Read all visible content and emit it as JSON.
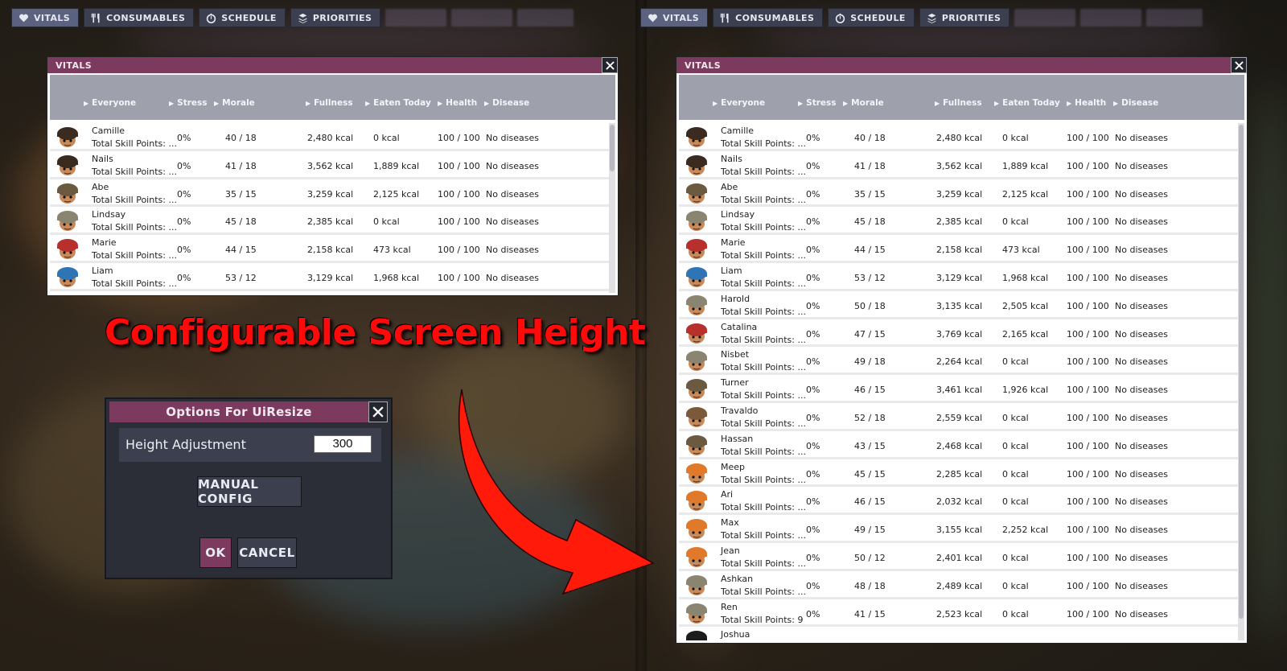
{
  "topbar": {
    "buttons": [
      {
        "label": "VITALS",
        "icon": "heart-icon"
      },
      {
        "label": "CONSUMABLES",
        "icon": "fork-knife-icon"
      },
      {
        "label": "SCHEDULE",
        "icon": "stopwatch-icon"
      },
      {
        "label": "PRIORITIES",
        "icon": "priority-stack-icon"
      }
    ]
  },
  "vitals_window": {
    "title": "VITALS",
    "columns": [
      "Everyone",
      "Stress",
      "Morale",
      "Fullness",
      "Eaten Today",
      "Health",
      "Disease"
    ]
  },
  "duplicants": [
    {
      "name": "Camille",
      "skill": "Total Skill Points: ...",
      "stress": "0%",
      "morale": "40 / 18",
      "fullness": "2,480 kcal",
      "eaten": "0 kcal",
      "health": "100 / 100",
      "disease": "No diseases",
      "hat": "miner"
    },
    {
      "name": "Nails",
      "skill": "Total Skill Points: ...",
      "stress": "0%",
      "morale": "41 / 18",
      "fullness": "3,562 kcal",
      "eaten": "1,889 kcal",
      "health": "100 / 100",
      "disease": "No diseases",
      "hat": "miner"
    },
    {
      "name": "Abe",
      "skill": "Total Skill Points: ...",
      "stress": "0%",
      "morale": "35 / 15",
      "fullness": "3,259 kcal",
      "eaten": "2,125 kcal",
      "health": "100 / 100",
      "disease": "No diseases",
      "hat": "ranger"
    },
    {
      "name": "Lindsay",
      "skill": "Total Skill Points: ...",
      "stress": "0%",
      "morale": "45 / 18",
      "fullness": "2,385 kcal",
      "eaten": "0 kcal",
      "health": "100 / 100",
      "disease": "No diseases",
      "hat": "camo"
    },
    {
      "name": "Marie",
      "skill": "Total Skill Points: ...",
      "stress": "0%",
      "morale": "44 / 15",
      "fullness": "2,158 kcal",
      "eaten": "473 kcal",
      "health": "100 / 100",
      "disease": "No diseases",
      "hat": "red"
    },
    {
      "name": "Liam",
      "skill": "Total Skill Points: ...",
      "stress": "0%",
      "morale": "53 / 12",
      "fullness": "3,129 kcal",
      "eaten": "1,968 kcal",
      "health": "100 / 100",
      "disease": "No diseases",
      "hat": "blue"
    },
    {
      "name": "Harold",
      "skill": "Total Skill Points: ...",
      "stress": "0%",
      "morale": "50 / 18",
      "fullness": "3,135 kcal",
      "eaten": "2,505 kcal",
      "health": "100 / 100",
      "disease": "No diseases",
      "hat": "camo"
    },
    {
      "name": "Catalina",
      "skill": "Total Skill Points: ...",
      "stress": "0%",
      "morale": "47 / 15",
      "fullness": "3,769 kcal",
      "eaten": "2,165 kcal",
      "health": "100 / 100",
      "disease": "No diseases",
      "hat": "red"
    },
    {
      "name": "Nisbet",
      "skill": "Total Skill Points: ...",
      "stress": "0%",
      "morale": "49 / 18",
      "fullness": "2,264 kcal",
      "eaten": "0 kcal",
      "health": "100 / 100",
      "disease": "No diseases",
      "hat": "camo"
    },
    {
      "name": "Turner",
      "skill": "Total Skill Points: ...",
      "stress": "0%",
      "morale": "46 / 15",
      "fullness": "3,461 kcal",
      "eaten": "1,926 kcal",
      "health": "100 / 100",
      "disease": "No diseases",
      "hat": "ranger"
    },
    {
      "name": "Travaldo",
      "skill": "Total Skill Points: ...",
      "stress": "0%",
      "morale": "52 / 18",
      "fullness": "2,559 kcal",
      "eaten": "0 kcal",
      "health": "100 / 100",
      "disease": "No diseases",
      "hat": "brown"
    },
    {
      "name": "Hassan",
      "skill": "Total Skill Points: ...",
      "stress": "0%",
      "morale": "43 / 15",
      "fullness": "2,468 kcal",
      "eaten": "0 kcal",
      "health": "100 / 100",
      "disease": "No diseases",
      "hat": "ranger"
    },
    {
      "name": "Meep",
      "skill": "Total Skill Points: ...",
      "stress": "0%",
      "morale": "45 / 15",
      "fullness": "2,285 kcal",
      "eaten": "0 kcal",
      "health": "100 / 100",
      "disease": "No diseases",
      "hat": "orange"
    },
    {
      "name": "Ari",
      "skill": "Total Skill Points: ...",
      "stress": "0%",
      "morale": "46 / 15",
      "fullness": "2,032 kcal",
      "eaten": "0 kcal",
      "health": "100 / 100",
      "disease": "No diseases",
      "hat": "orange"
    },
    {
      "name": "Max",
      "skill": "Total Skill Points: ...",
      "stress": "0%",
      "morale": "49 / 15",
      "fullness": "3,155 kcal",
      "eaten": "2,252 kcal",
      "health": "100 / 100",
      "disease": "No diseases",
      "hat": "orange"
    },
    {
      "name": "Jean",
      "skill": "Total Skill Points: ...",
      "stress": "0%",
      "morale": "50 / 12",
      "fullness": "2,401 kcal",
      "eaten": "0 kcal",
      "health": "100 / 100",
      "disease": "No diseases",
      "hat": "orange"
    },
    {
      "name": "Ashkan",
      "skill": "Total Skill Points: ...",
      "stress": "0%",
      "morale": "48 / 18",
      "fullness": "2,489 kcal",
      "eaten": "0 kcal",
      "health": "100 / 100",
      "disease": "No diseases",
      "hat": "camo"
    },
    {
      "name": "Ren",
      "skill": "Total Skill Points: 9",
      "stress": "0%",
      "morale": "41 / 15",
      "fullness": "2,523 kcal",
      "eaten": "0 kcal",
      "health": "100 / 100",
      "disease": "No diseases",
      "hat": "camo"
    },
    {
      "name": "Joshua",
      "skill": "",
      "stress": "",
      "morale": "",
      "fullness": "",
      "eaten": "",
      "health": "",
      "disease": "",
      "hat": "black"
    }
  ],
  "hat_colors": {
    "miner": "#3b2a20",
    "ranger": "#6b5a40",
    "camo": "#8a8570",
    "red": "#b8302c",
    "blue": "#2f74b5",
    "brown": "#7a5a3a",
    "orange": "#e07a2a",
    "black": "#1c1c1c"
  },
  "banner": {
    "text": "Configurable Screen Height",
    "color": "#ff0a0a"
  },
  "options_dialog": {
    "title": "Options For UiResize",
    "height_label": "Height Adjustment",
    "height_value": "300",
    "manual_config_label": "MANUAL CONFIG",
    "ok_label": "OK",
    "cancel_label": "CANCEL"
  },
  "colors": {
    "title_bar": "#7d3a5f",
    "header_bg": "#9ea1ab",
    "arrow": "#ff1a0a"
  }
}
